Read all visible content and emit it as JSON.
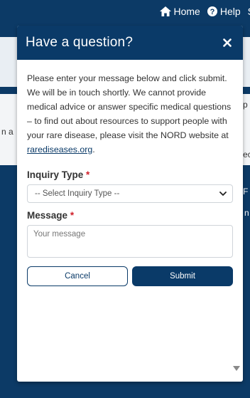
{
  "background": {
    "nav": {
      "home_label": "Home",
      "help_label": "Help",
      "more_label": "S"
    },
    "fragments": {
      "left_a": "n a",
      "right_p": "p",
      "right_ec": "ec",
      "right_f": "F",
      "right_n": "n"
    }
  },
  "modal": {
    "title": "Have a question?",
    "intro_text": "Please enter your message below and click submit. We will be in touch shortly. We cannot provide medical advice or answer specific medical questions – to find out about resources to support people with your rare disease, please visit the NORD website at ",
    "link_text": "rarediseases.org",
    "intro_suffix": ".",
    "inquiry_label": "Inquiry Type",
    "required_mark": "*",
    "inquiry_select_value": "-- Select Inquiry Type --",
    "message_label": "Message",
    "message_placeholder": "Your message",
    "cancel_label": "Cancel",
    "submit_label": "Submit"
  },
  "colors": {
    "primary": "#0a3a68",
    "required": "#d0202a"
  }
}
